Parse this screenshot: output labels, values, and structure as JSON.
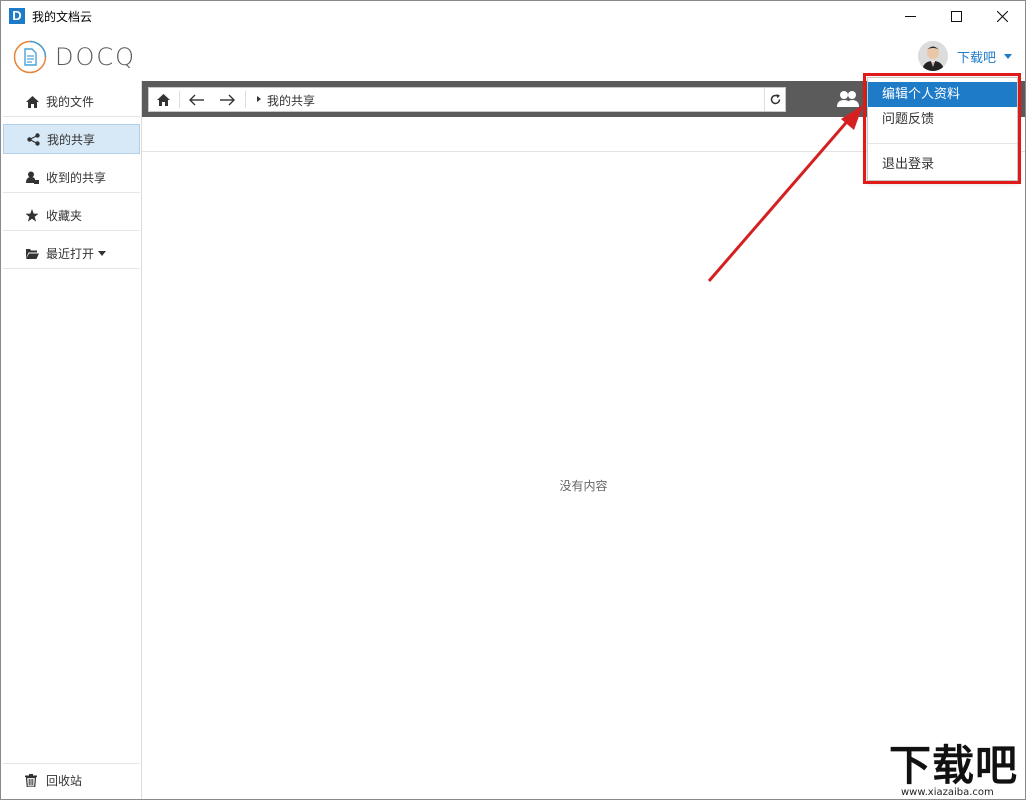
{
  "window": {
    "title": "我的文档云",
    "app_icon_letter": "D",
    "controls": {
      "minimize": "minimize-icon",
      "maximize": "maximize-icon",
      "close": "close-icon"
    }
  },
  "header": {
    "logo_text": "DOCQ",
    "user_name": "下载吧"
  },
  "sidebar": {
    "items": [
      {
        "label": "我的文件",
        "icon": "home-icon"
      },
      {
        "label": "我的共享",
        "icon": "share-icon",
        "active": true
      },
      {
        "label": "收到的共享",
        "icon": "received-share-icon"
      },
      {
        "label": "收藏夹",
        "icon": "star-icon"
      },
      {
        "label": "最近打开",
        "icon": "folder-open-icon",
        "has_dropdown": true
      }
    ],
    "bottom": {
      "label": "回收站",
      "icon": "trash-icon"
    }
  },
  "toolbar": {
    "breadcrumb": "我的共享"
  },
  "main": {
    "empty_text": "没有内容"
  },
  "user_menu": {
    "items": [
      {
        "label": "编辑个人资料",
        "active": true
      },
      {
        "label": "问题反馈"
      },
      {
        "label": "退出登录"
      }
    ]
  },
  "watermark": {
    "title": "下载吧",
    "url": "www.xiazaiba.com"
  },
  "colors": {
    "accent": "#1e7bc8",
    "toolbar_bg": "#5b5b5b",
    "annotation_red": "#e01919",
    "sidebar_active": "#d7e8f6"
  }
}
